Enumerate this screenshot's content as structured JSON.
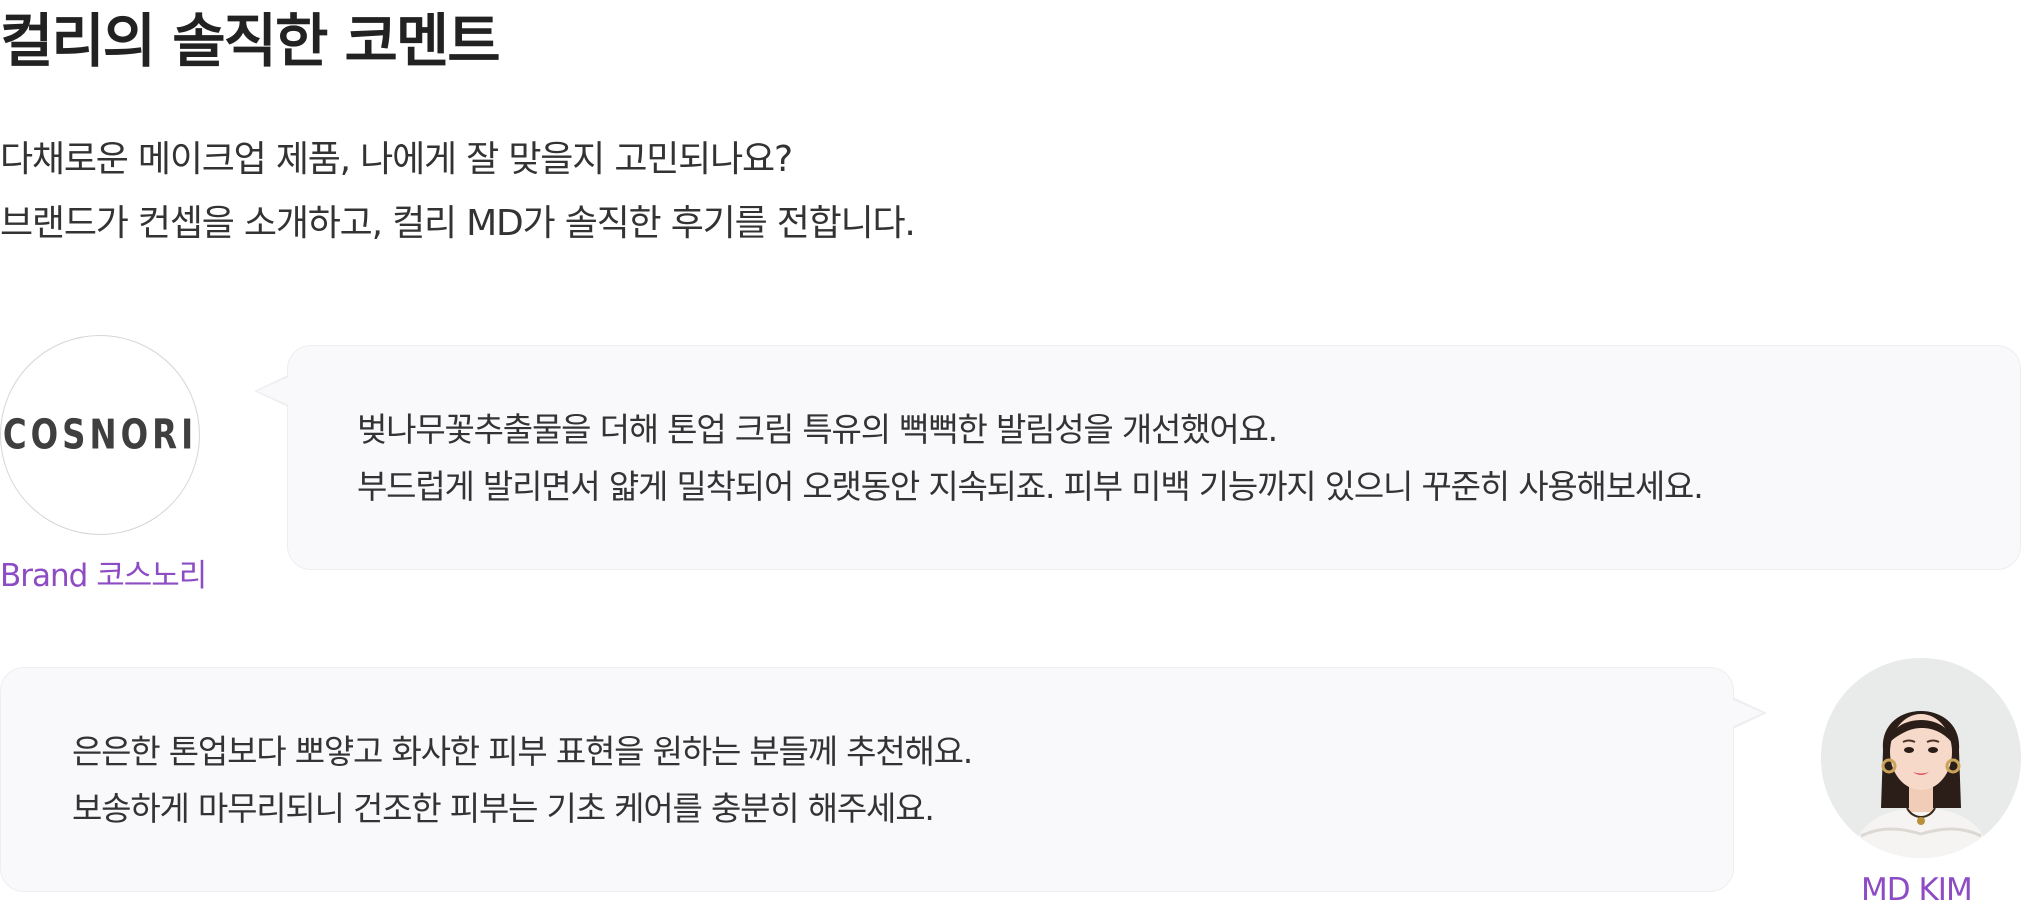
{
  "section": {
    "title": "컬리의 솔직한 코멘트",
    "intro_lines": [
      "다채로운 메이크업 제품, 나에게 잘 맞을지 고민되나요?",
      "브랜드가 컨셉을 소개하고, 컬리 MD가 솔직한 후기를 전합니다."
    ]
  },
  "brand": {
    "logo_text": "COSNORI",
    "label": "Brand 코스노리",
    "comment_lines": [
      "벚나무꽃추출물을 더해 톤업 크림 특유의 뻑뻑한 발림성을 개선했어요.",
      "부드럽게 발리면서 얇게 밀착되어 오랫동안 지속되죠. 피부 미백 기능까지 있으니 꾸준히 사용해보세요."
    ]
  },
  "md": {
    "label": "MD KIM",
    "avatar_icon": "person-portrait",
    "comment_lines": [
      "은은한 톤업보다 뽀얗고 화사한 피부 표현을 원하는 분들께 추천해요.",
      "보송하게 마무리되니 건조한 피부는 기초 케어를 충분히 해주세요."
    ]
  },
  "colors": {
    "accent": "#8d4cc4",
    "bubble_bg": "#f9f9fb",
    "bubble_border": "#eeeef1",
    "text": "#333333"
  }
}
